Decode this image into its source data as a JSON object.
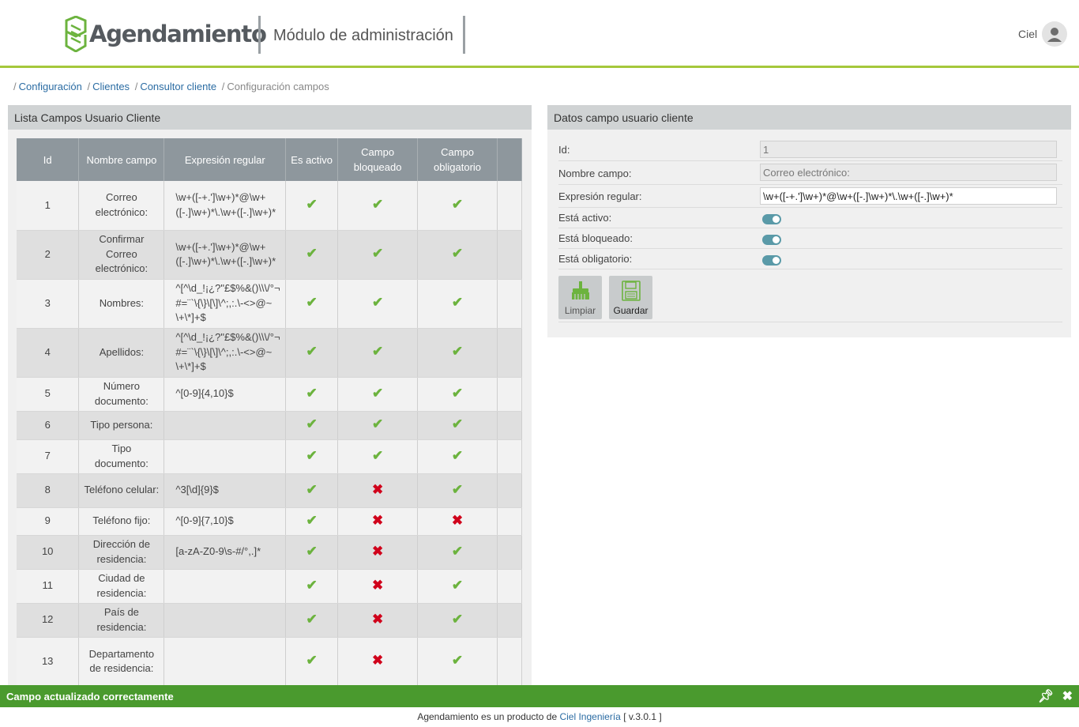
{
  "header": {
    "logo_text": "Agendamiento",
    "module_title": "Módulo de administración",
    "user_name": "Ciel"
  },
  "breadcrumb": {
    "items": [
      "Configuración",
      "Clientes",
      "Consultor cliente"
    ],
    "current": "Configuración campos"
  },
  "list_panel": {
    "title": "Lista Campos Usuario Cliente",
    "columns": [
      "Id",
      "Nombre campo",
      "Expresión regular",
      "Es activo",
      "Campo bloqueado",
      "Campo obligatorio"
    ],
    "rows": [
      {
        "id": "1",
        "name": "Correo electrónico:",
        "regex": "\\w+([-+.']\\w+)*@\\w+([-.]\\w+)*\\.\\w+([-.]\\w+)*",
        "active": true,
        "locked": true,
        "required": true
      },
      {
        "id": "2",
        "name": "Confirmar Correo electrónico:",
        "regex": "\\w+([-+.']\\w+)*@\\w+([-.]\\w+)*\\.\\w+([-.]\\w+)*",
        "active": true,
        "locked": true,
        "required": true
      },
      {
        "id": "3",
        "name": "Nombres:",
        "regex": "^[^\\d_!¡¿?\"£$%&()\\\\\\/°¬#=¨`\\{\\}\\[\\]\\^;,:.\\-<>@~\\+\\*]+$",
        "active": true,
        "locked": true,
        "required": true
      },
      {
        "id": "4",
        "name": "Apellidos:",
        "regex": "^[^\\d_!¡¿?\"£$%&()\\\\\\/°¬#=¨`\\{\\}\\[\\]\\^;,:.\\-<>@~\\+\\*]+$",
        "active": true,
        "locked": true,
        "required": true
      },
      {
        "id": "5",
        "name": "Número documento:",
        "regex": "^[0-9]{4,10}$",
        "active": true,
        "locked": true,
        "required": true
      },
      {
        "id": "6",
        "name": "Tipo persona:",
        "regex": "",
        "active": true,
        "locked": true,
        "required": true
      },
      {
        "id": "7",
        "name": "Tipo documento:",
        "regex": "",
        "active": true,
        "locked": true,
        "required": true
      },
      {
        "id": "8",
        "name": "Teléfono celular:",
        "regex": "^3[\\d]{9}$",
        "active": true,
        "locked": false,
        "required": true
      },
      {
        "id": "9",
        "name": "Teléfono fijo:",
        "regex": "^[0-9]{7,10}$",
        "active": true,
        "locked": false,
        "required": false
      },
      {
        "id": "10",
        "name": "Dirección de residencia:",
        "regex": "[a-zA-Z0-9\\s-#/°,.]*",
        "active": true,
        "locked": false,
        "required": true
      },
      {
        "id": "11",
        "name": "Ciudad de residencia:",
        "regex": "",
        "active": true,
        "locked": false,
        "required": true
      },
      {
        "id": "12",
        "name": "País de residencia:",
        "regex": "",
        "active": true,
        "locked": false,
        "required": true
      },
      {
        "id": "13",
        "name": "Departamento de residencia:",
        "regex": "",
        "active": true,
        "locked": false,
        "required": true
      }
    ]
  },
  "detail_panel": {
    "title": "Datos campo usuario cliente",
    "id_label": "Id:",
    "id_value": "1",
    "name_label": "Nombre campo:",
    "name_value": "Correo electrónico:",
    "regex_label": "Expresión regular:",
    "regex_value": "\\w+([-+.']\\w+)*@\\w+([-.]\\w+)*\\.\\w+([-.]\\w+)*",
    "active_label": "Está activo:",
    "locked_label": "Está bloqueado:",
    "required_label": "Está obligatorio:",
    "active": true,
    "locked": true,
    "required": true,
    "clear_button": "Limpiar",
    "save_button": "Guardar"
  },
  "notification": {
    "message": "Campo actualizado correctamente"
  },
  "footer": {
    "text_before": "Agendamiento es un producto de",
    "company": "Ciel Ingeniería",
    "version": "[ v.3.0.1 ]"
  },
  "colors": {
    "accent_green": "#a5c83c",
    "check_green": "#6cb33e",
    "cross_red": "#d0021b",
    "notification_green": "#4a9a2e",
    "toggle_on": "#5a9aa8",
    "table_header": "#8e979d"
  },
  "icons": {
    "check": "check-icon",
    "cross": "cross-icon",
    "user": "user-avatar-icon",
    "broom": "broom-icon",
    "save": "floppy-disk-icon",
    "pin": "pin-icon",
    "close": "close-icon"
  }
}
